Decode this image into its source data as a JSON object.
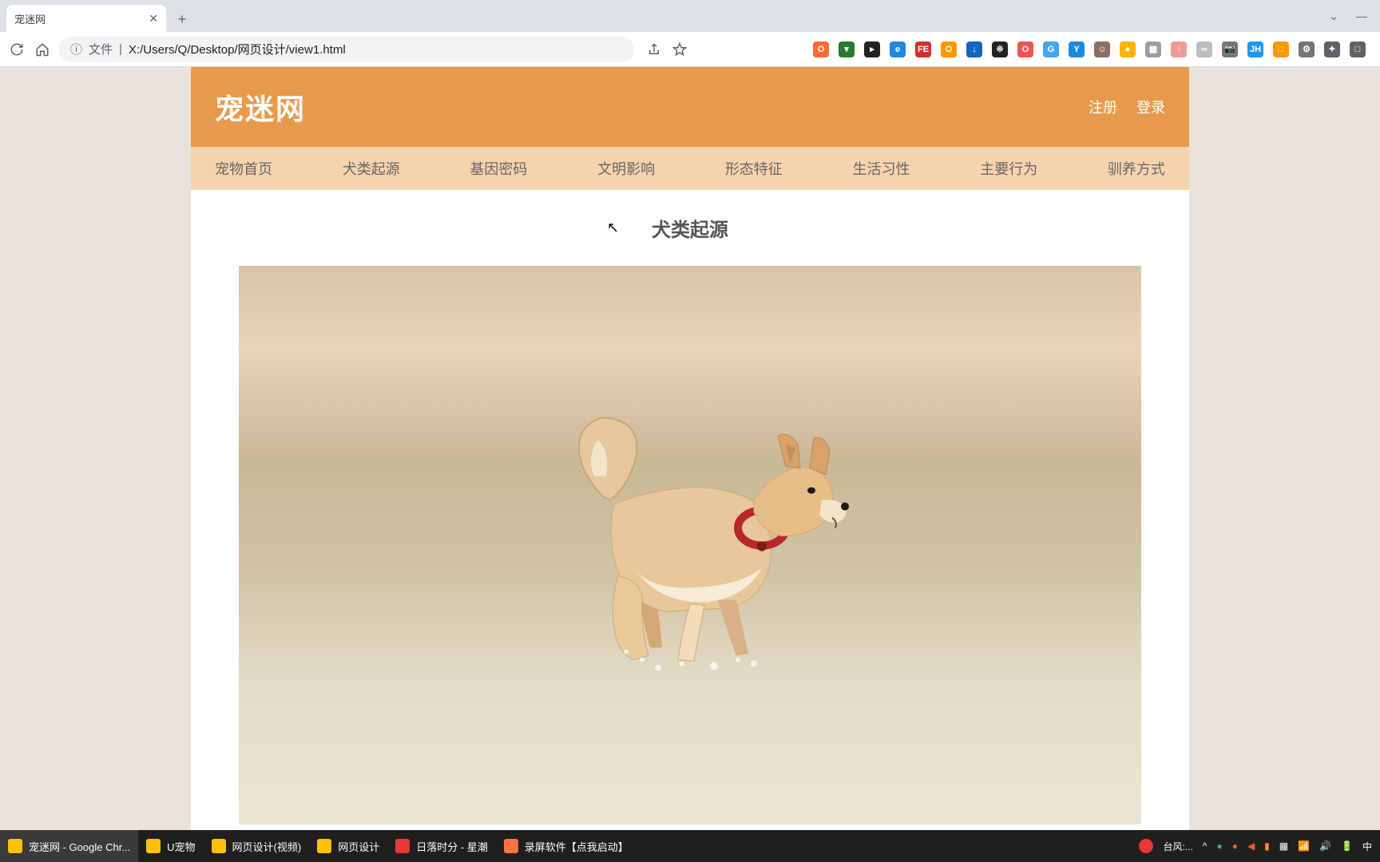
{
  "browser": {
    "tab_title": "宠迷网",
    "url_prefix": "文件",
    "url": "X:/Users/Q/Desktop/网页设计/view1.html",
    "extensions": [
      {
        "bg": "#ff6b35",
        "txt": "O"
      },
      {
        "bg": "#2c7a2c",
        "txt": "▾"
      },
      {
        "bg": "#222",
        "txt": "▸"
      },
      {
        "bg": "#1e88e5",
        "txt": "e"
      },
      {
        "bg": "#d32f2f",
        "txt": "FE"
      },
      {
        "bg": "#ff9800",
        "txt": "O"
      },
      {
        "bg": "#1565c0",
        "txt": "↓"
      },
      {
        "bg": "#222",
        "txt": "※"
      },
      {
        "bg": "#ef5350",
        "txt": "O"
      },
      {
        "bg": "#42a5f5",
        "txt": "G"
      },
      {
        "bg": "#1e88e5",
        "txt": "Y"
      },
      {
        "bg": "#8d6e63",
        "txt": "☺"
      },
      {
        "bg": "#ffb300",
        "txt": "●"
      },
      {
        "bg": "#9e9e9e",
        "txt": "▦"
      },
      {
        "bg": "#ef9a9a",
        "txt": "♀"
      },
      {
        "bg": "#bdbdbd",
        "txt": "∞"
      },
      {
        "bg": "#757575",
        "txt": "📷"
      },
      {
        "bg": "#2196f3",
        "txt": "JH"
      },
      {
        "bg": "#ff9800",
        "txt": "□"
      },
      {
        "bg": "#757575",
        "txt": "⚙"
      },
      {
        "bg": "#5f6368",
        "txt": "✦"
      },
      {
        "bg": "#5f6368",
        "txt": "□"
      }
    ]
  },
  "site": {
    "title": "宠迷网",
    "auth": {
      "register": "注册",
      "login": "登录"
    },
    "nav": [
      "宠物首页",
      "犬类起源",
      "基因密码",
      "文明影响",
      "形态特征",
      "生活习性",
      "主要行为",
      "驯养方式"
    ],
    "page_heading": "犬类起源"
  },
  "taskbar": {
    "items": [
      {
        "label": "宠迷网 - Google Chr...",
        "color": "#ffc107",
        "active": true
      },
      {
        "label": "U宠物",
        "color": "#ffc107"
      },
      {
        "label": "网页设计(视频)",
        "color": "#ffc107"
      },
      {
        "label": "网页设计",
        "color": "#ffc107"
      },
      {
        "label": "日落时分 - 星潮",
        "color": "#e53935"
      },
      {
        "label": "录屏软件【点我启动】",
        "color": "#ff7043"
      }
    ],
    "tray": {
      "weather": "台风:...",
      "ime": "中"
    }
  }
}
